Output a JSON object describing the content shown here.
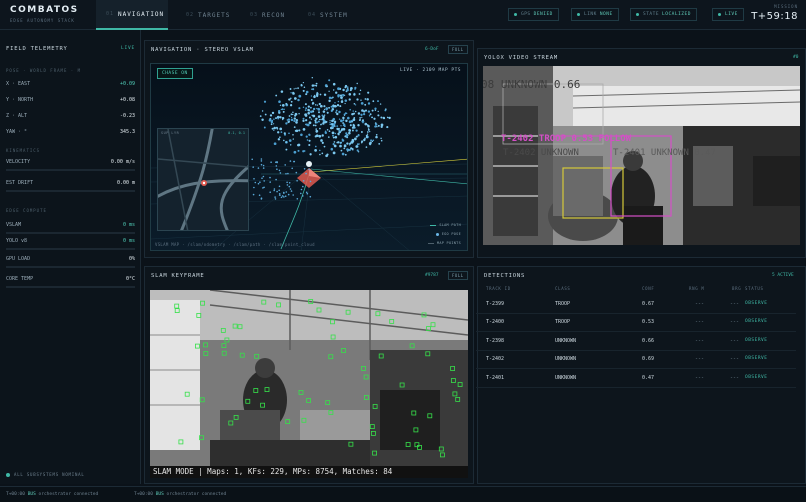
{
  "brand": {
    "title": "COMBATOS",
    "subtitle": "EDGE AUTONOMY STACK"
  },
  "tabs": [
    {
      "num": "01",
      "label": "NAVIGATION"
    },
    {
      "num": "02",
      "label": "TARGETS"
    },
    {
      "num": "03",
      "label": "RECON"
    },
    {
      "num": "04",
      "label": "SYSTEM"
    }
  ],
  "status": {
    "gps_label": "GPS",
    "gps_value": "DENIED",
    "link_label": "LINK",
    "link_value": "NONE",
    "state_label": "STATE",
    "state_value": "LOCALIZED",
    "live": "LIVE"
  },
  "mission": {
    "label": "MISSION",
    "clock": "T+59:18"
  },
  "sidebar": {
    "title": "FIELD TELEMETRY",
    "live": "LIVE",
    "pose_label": "POSE · WORLD FRAME · M",
    "pose": [
      {
        "label": "X · EAST",
        "value": "+0.09"
      },
      {
        "label": "Y · NORTH",
        "value": "+0.08"
      },
      {
        "label": "Z · ALT",
        "value": "-0.23"
      },
      {
        "label": "YAW · °",
        "value": "345.3"
      }
    ],
    "kinematics_label": "KINEMATICS",
    "velocity": {
      "label": "VELOCITY",
      "value": "0.00 m/s"
    },
    "drift": {
      "label": "EST DRIFT",
      "value": "0.00 m"
    },
    "edge_label": "EDGE COMPUTE",
    "edge": [
      {
        "label": "VSLAM",
        "value": "0 ms"
      },
      {
        "label": "YOLO v8",
        "value": "0 ms"
      },
      {
        "label": "GPU LOAD",
        "value": "0%"
      },
      {
        "label": "CORE TEMP",
        "value": "0°C"
      }
    ],
    "footer": "ALL SUBSYSTEMS NOMINAL"
  },
  "nav_panel": {
    "title": "NAVIGATION · STEREO VSLAM",
    "dof": "6-DoF",
    "full": "FULL",
    "chase": "CHASE ON",
    "live_pts": "LIVE · 2109 MAP PTS",
    "minimap_label": "SUP LYR",
    "minimap_coord": "0.1, 0.1",
    "footer": "VSLAM MAP · /slam/odometry · /slam/path · /slam/point_cloud",
    "legend": [
      "SLAM PATH",
      "EGO POSE",
      "MAP POINTS"
    ]
  },
  "yolo_panel": {
    "title": "YOLOX VIDEO STREAM",
    "tag": "#0",
    "overlay": {
      "top_left": "08  UNKNOWN  0.66",
      "magenta": "T-2402  TROOP  0.53  FOLLOW",
      "gray1": "T-2402  UNKNOWN",
      "gray2": "T-2401  UNKNOWN  0.47"
    }
  },
  "keyframe_panel": {
    "title": "SLAM KEYFRAME",
    "tag": "#9787",
    "full": "FULL",
    "caption": "SLAM MODE |  Maps: 1, KFs: 229, MPs: 8754, Matches: 84"
  },
  "detections": {
    "title": "DETECTIONS",
    "count": "5 ACTIVE",
    "headers": [
      "TRACK ID",
      "CLASS",
      "CONF",
      "RNG M",
      "BRG",
      "STATUS"
    ],
    "rows": [
      {
        "id": "T-2399",
        "cls": "TROOP",
        "conf": "0.67",
        "rng": "---",
        "brg": "---",
        "status": "OBSERVE"
      },
      {
        "id": "T-2400",
        "cls": "TROOP",
        "conf": "0.53",
        "rng": "---",
        "brg": "---",
        "status": "OBSERVE"
      },
      {
        "id": "T-2398",
        "cls": "UNKNOWN",
        "conf": "0.66",
        "rng": "---",
        "brg": "---",
        "status": "OBSERVE"
      },
      {
        "id": "T-2402",
        "cls": "UNKNOWN",
        "conf": "0.69",
        "rng": "---",
        "brg": "---",
        "status": "OBSERVE"
      },
      {
        "id": "T-2401",
        "cls": "UNKNOWN",
        "conf": "0.47",
        "rng": "---",
        "brg": "---",
        "status": "OBSERVE"
      }
    ]
  },
  "log": [
    {
      "time": "T+00:00",
      "tag": "BUS",
      "text": "orchestrator connected"
    },
    {
      "time": "T+00:00",
      "tag": "BUS",
      "text": "orchestrator connected"
    }
  ]
}
